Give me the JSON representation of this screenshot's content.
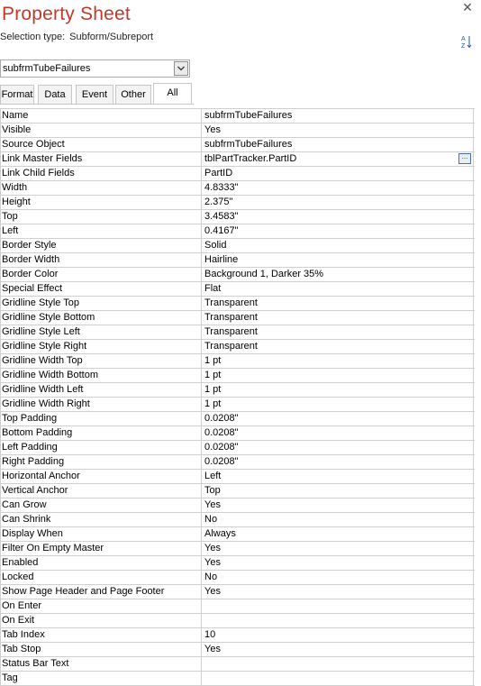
{
  "panel": {
    "title": "Property Sheet",
    "selection_type_label": "Selection type:",
    "selection_type_value": "Subform/Subreport",
    "close_glyph": "✕",
    "sort_icon": "sort-a-z-icon"
  },
  "selector": {
    "value": "subfrmTubeFailures"
  },
  "tabs": [
    {
      "label": "Format",
      "active": false
    },
    {
      "label": "Data",
      "active": false
    },
    {
      "label": "Event",
      "active": false
    },
    {
      "label": "Other",
      "active": false
    },
    {
      "label": "All",
      "active": true
    }
  ],
  "properties": [
    {
      "name": "Name",
      "value": "subfrmTubeFailures"
    },
    {
      "name": "Visible",
      "value": "Yes"
    },
    {
      "name": "Source Object",
      "value": "subfrmTubeFailures"
    },
    {
      "name": "Link Master Fields",
      "value": "tblPartTracker.PartID",
      "builder": true
    },
    {
      "name": "Link Child Fields",
      "value": "PartID"
    },
    {
      "name": "Width",
      "value": "4.8333\""
    },
    {
      "name": "Height",
      "value": "2.375\""
    },
    {
      "name": "Top",
      "value": "3.4583\""
    },
    {
      "name": "Left",
      "value": "0.4167\""
    },
    {
      "name": "Border Style",
      "value": "Solid"
    },
    {
      "name": "Border Width",
      "value": "Hairline"
    },
    {
      "name": "Border Color",
      "value": "Background 1, Darker 35%"
    },
    {
      "name": "Special Effect",
      "value": "Flat"
    },
    {
      "name": "Gridline Style Top",
      "value": "Transparent"
    },
    {
      "name": "Gridline Style Bottom",
      "value": "Transparent"
    },
    {
      "name": "Gridline Style Left",
      "value": "Transparent"
    },
    {
      "name": "Gridline Style Right",
      "value": "Transparent"
    },
    {
      "name": "Gridline Width Top",
      "value": "1 pt"
    },
    {
      "name": "Gridline Width Bottom",
      "value": "1 pt"
    },
    {
      "name": "Gridline Width Left",
      "value": "1 pt"
    },
    {
      "name": "Gridline Width Right",
      "value": "1 pt"
    },
    {
      "name": "Top Padding",
      "value": "0.0208\""
    },
    {
      "name": "Bottom Padding",
      "value": "0.0208\""
    },
    {
      "name": "Left Padding",
      "value": "0.0208\""
    },
    {
      "name": "Right Padding",
      "value": "0.0208\""
    },
    {
      "name": "Horizontal Anchor",
      "value": "Left"
    },
    {
      "name": "Vertical Anchor",
      "value": "Top"
    },
    {
      "name": "Can Grow",
      "value": "Yes"
    },
    {
      "name": "Can Shrink",
      "value": "No"
    },
    {
      "name": "Display When",
      "value": "Always"
    },
    {
      "name": "Filter On Empty Master",
      "value": "Yes"
    },
    {
      "name": "Enabled",
      "value": "Yes"
    },
    {
      "name": "Locked",
      "value": "No"
    },
    {
      "name": "Show Page Header and Page Footer",
      "value": "Yes"
    },
    {
      "name": "On Enter",
      "value": ""
    },
    {
      "name": "On Exit",
      "value": ""
    },
    {
      "name": "Tab Index",
      "value": "10"
    },
    {
      "name": "Tab Stop",
      "value": "Yes"
    },
    {
      "name": "Status Bar Text",
      "value": ""
    },
    {
      "name": "Tag",
      "value": ""
    }
  ],
  "colors": {
    "title": "#c0392b",
    "grid": "#d0d0d0"
  }
}
